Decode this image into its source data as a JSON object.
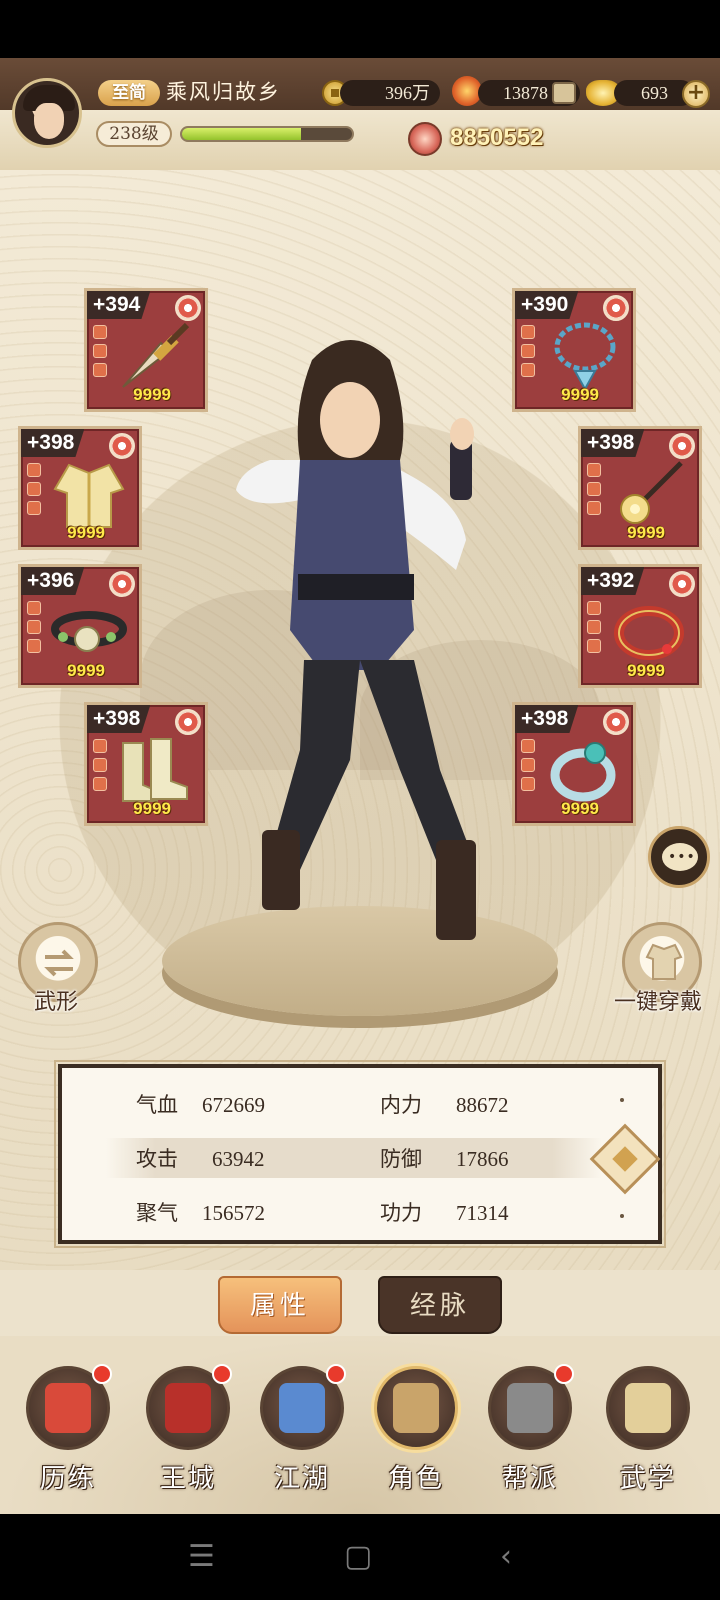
{
  "player": {
    "vip_label": "至简",
    "name": "乘风归故乡",
    "level_label": "238级",
    "exp_progress": 0.7
  },
  "resources": {
    "coins": "396万",
    "flame": "13878",
    "gold": "693",
    "combat_power": "8850552"
  },
  "equipment": {
    "left": [
      {
        "level": "+394",
        "qty": "9999",
        "icon": "dagger-icon"
      },
      {
        "level": "+398",
        "qty": "9999",
        "icon": "robe-icon"
      },
      {
        "level": "+396",
        "qty": "9999",
        "icon": "belt-icon"
      },
      {
        "level": "+398",
        "qty": "9999",
        "icon": "boots-icon"
      }
    ],
    "right": [
      {
        "level": "+390",
        "qty": "9999",
        "icon": "necklace-icon"
      },
      {
        "level": "+398",
        "qty": "9999",
        "icon": "hairpin-icon"
      },
      {
        "level": "+392",
        "qty": "9999",
        "icon": "bracelet-icon"
      },
      {
        "level": "+398",
        "qty": "9999",
        "icon": "ring-icon"
      }
    ]
  },
  "buttons": {
    "wuxing": "武形",
    "one_key_equip": "一键穿戴"
  },
  "stats": {
    "qixue_label": "气血",
    "qixue_value": "672669",
    "neili_label": "内力",
    "neili_value": "88672",
    "gongji_label": "攻击",
    "gongji_value": "63942",
    "fangyu_label": "防御",
    "fangyu_value": "17866",
    "juqi_label": "聚气",
    "juqi_value": "156572",
    "gongli_label": "功力",
    "gongli_value": "71314"
  },
  "tabs": {
    "attributes": "属性",
    "meridians": "经脉"
  },
  "nav": {
    "items": [
      {
        "label": "历练"
      },
      {
        "label": "王城"
      },
      {
        "label": "江湖"
      },
      {
        "label": "角色"
      },
      {
        "label": "帮派"
      },
      {
        "label": "武学"
      }
    ]
  },
  "colors": {
    "accent": "#e4935a",
    "equip_bg": "#9c3e3e",
    "header_bg": "#4e3626",
    "qty_yellow": "#ffe94a"
  }
}
